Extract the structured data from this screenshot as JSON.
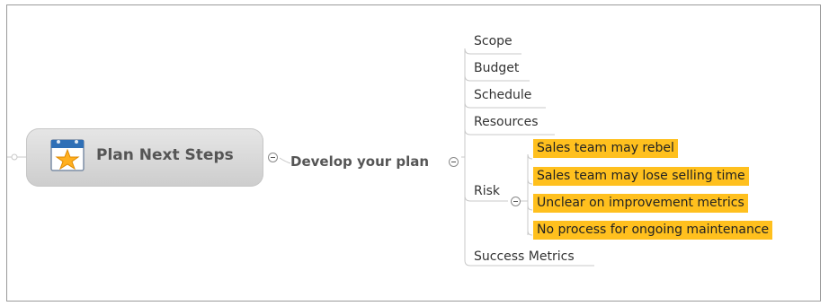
{
  "central_topic": {
    "title": "Plan Next Steps",
    "icon": "calendar-star-icon"
  },
  "main_topic": {
    "title": "Develop your plan"
  },
  "subtopics": [
    "Scope",
    "Budget",
    "Schedule",
    "Resources",
    "Risk",
    "Success Metrics"
  ],
  "risk_items": [
    "Sales team may rebel",
    "Sales team may lose selling time",
    "Unclear on improvement metrics",
    "No process for ongoing maintenance"
  ],
  "colors": {
    "risk_highlight": "#ffc01e",
    "connector": "#c8c8c8"
  }
}
